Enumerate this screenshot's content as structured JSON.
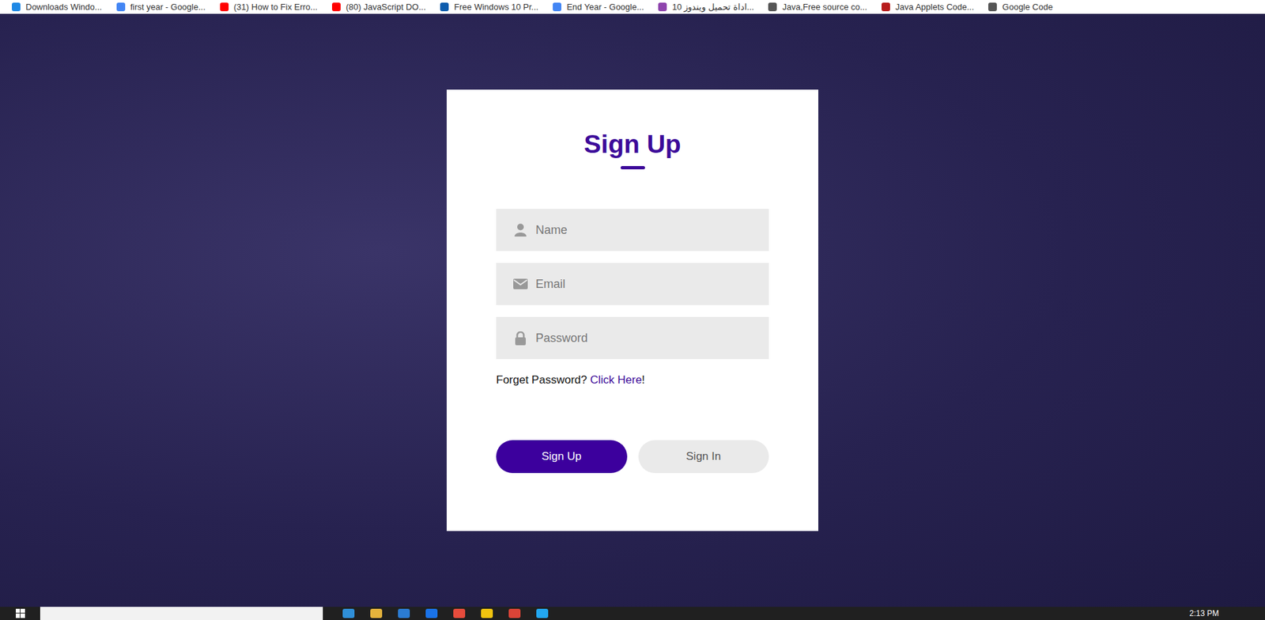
{
  "bookmarks": [
    {
      "label": "Downloads Windo...",
      "color": "#1e88e5"
    },
    {
      "label": "first year - Google...",
      "color": "#4285f4"
    },
    {
      "label": "(31) How to Fix Erro...",
      "color": "#ff0000"
    },
    {
      "label": "(80) JavaScript DO...",
      "color": "#ff0000"
    },
    {
      "label": "Free Windows 10 Pr...",
      "color": "#0b5cad"
    },
    {
      "label": "End Year - Google...",
      "color": "#4285f4"
    },
    {
      "label": "اداة تحميل ويندوز 10...",
      "color": "#8e44ad"
    },
    {
      "label": "Java,Free source co...",
      "color": "#555555"
    },
    {
      "label": "Java Applets Code...",
      "color": "#b71c1c"
    },
    {
      "label": "Google Code",
      "color": "#555555"
    }
  ],
  "form": {
    "title": "Sign Up",
    "fields": [
      {
        "placeholder": "Name"
      },
      {
        "placeholder": "Email"
      },
      {
        "placeholder": "Password"
      }
    ],
    "forgot": {
      "text": "Forget Password?",
      "link": "Click Here",
      "suffix": "!"
    },
    "buttons": [
      {
        "label": "Sign Up",
        "selected": true
      },
      {
        "label": "Sign In",
        "selected": false
      }
    ]
  },
  "taskbar": {
    "clock": "2:13 PM",
    "apps": [
      {
        "color": "#2f8fd8"
      },
      {
        "color": "#e6b43c"
      },
      {
        "color": "#2b7cd3"
      },
      {
        "color": "#1a73e8"
      },
      {
        "color": "#e74c3c"
      },
      {
        "color": "#f1c40f"
      },
      {
        "color": "#db4437"
      },
      {
        "color": "#22a7f0"
      }
    ]
  }
}
